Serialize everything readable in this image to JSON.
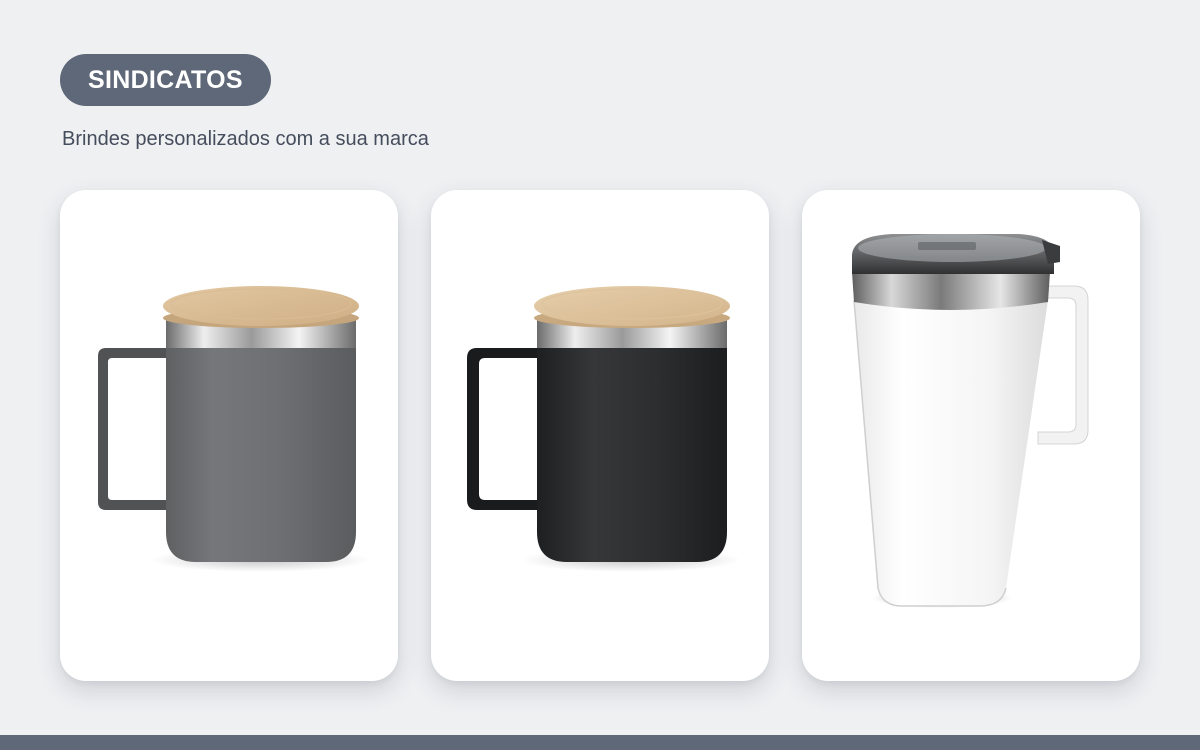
{
  "header": {
    "badge_label": "SINDICATOS",
    "subtitle": "Brindes personalizados com a sua marca"
  },
  "products": [
    {
      "icon": "gray-mug-bamboo-lid",
      "color": "#6e7072"
    },
    {
      "icon": "black-mug-bamboo-lid",
      "color": "#2c2d2f"
    },
    {
      "icon": "white-tumbler-handle",
      "color": "#f6f6f6"
    }
  ],
  "colors": {
    "background": "#eff0f2",
    "accent": "#5f6878",
    "text": "#454d5c",
    "card": "#ffffff"
  }
}
